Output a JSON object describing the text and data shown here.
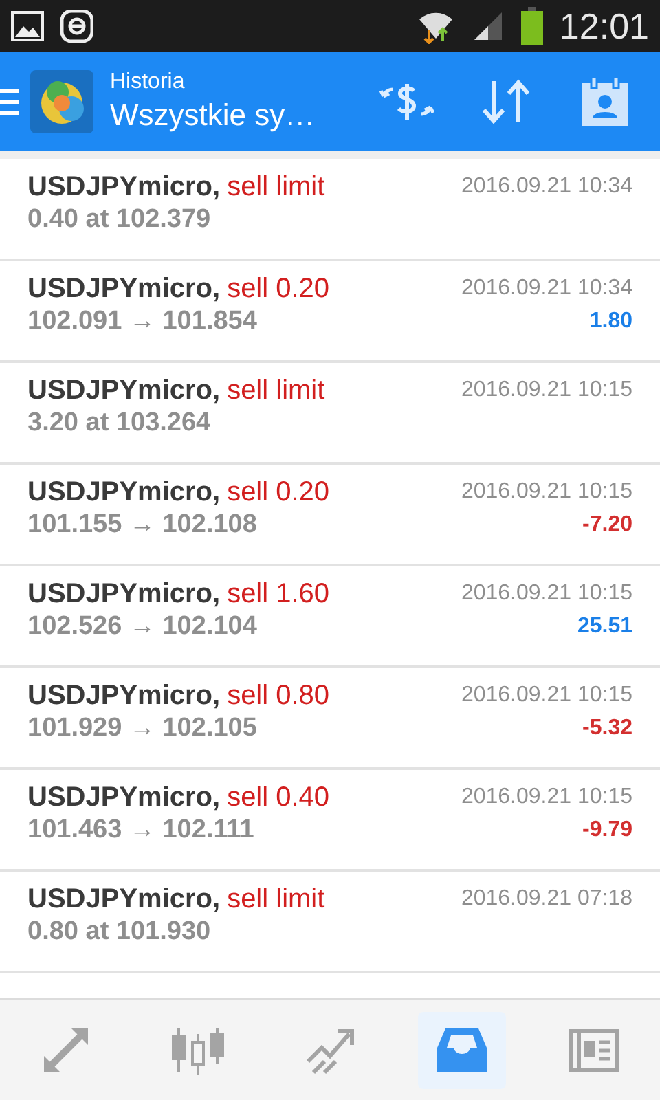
{
  "status_bar": {
    "time": "12:01"
  },
  "header": {
    "subtitle": "Historia",
    "title": "Wszystkie sy…"
  },
  "rows": [
    {
      "kind": "order",
      "symbol": "USDJPYmicro,",
      "action": "sell limit",
      "time": "2016.09.21 10:34",
      "detail": "0.40 at 102.379"
    },
    {
      "kind": "deal",
      "symbol": "USDJPYmicro,",
      "action": "sell 0.20",
      "time": "2016.09.21 10:34",
      "detail": "102.091 → 101.854",
      "profit": "1.80",
      "color": "#1a7fe8"
    },
    {
      "kind": "order",
      "symbol": "USDJPYmicro,",
      "action": "sell limit",
      "time": "2016.09.21 10:15",
      "detail": "3.20 at 103.264"
    },
    {
      "kind": "deal",
      "symbol": "USDJPYmicro,",
      "action": "sell 0.20",
      "time": "2016.09.21 10:15",
      "detail": "101.155 → 102.108",
      "profit": "-7.20",
      "color": "#d32f2f"
    },
    {
      "kind": "deal",
      "symbol": "USDJPYmicro,",
      "action": "sell 1.60",
      "time": "2016.09.21 10:15",
      "detail": "102.526 → 102.104",
      "profit": "25.51",
      "color": "#1a7fe8"
    },
    {
      "kind": "deal",
      "symbol": "USDJPYmicro,",
      "action": "sell 0.80",
      "time": "2016.09.21 10:15",
      "detail": "101.929 → 102.105",
      "profit": "-5.32",
      "color": "#d32f2f"
    },
    {
      "kind": "deal",
      "symbol": "USDJPYmicro,",
      "action": "sell 0.40",
      "time": "2016.09.21 10:15",
      "detail": "101.463 → 102.111",
      "profit": "-9.79",
      "color": "#d32f2f"
    },
    {
      "kind": "order",
      "symbol": "USDJPYmicro,",
      "action": "sell limit",
      "time": "2016.09.21 07:18",
      "detail": "0.80 at 101.930"
    }
  ],
  "bottom_nav": [
    {
      "kind": "quotes",
      "selected": false
    },
    {
      "kind": "chart",
      "selected": false
    },
    {
      "kind": "trade",
      "selected": false
    },
    {
      "kind": "history",
      "selected": true
    },
    {
      "kind": "news",
      "selected": false
    }
  ]
}
